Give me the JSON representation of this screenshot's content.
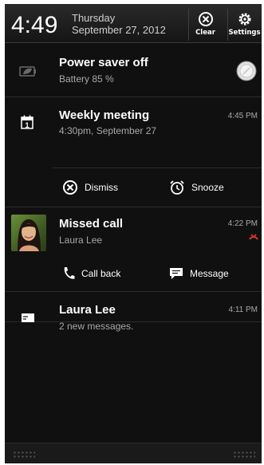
{
  "status": {
    "time": "4:49",
    "day": "Thursday",
    "date": "September 27, 2012",
    "clear_label": "Clear",
    "settings_label": "Settings"
  },
  "notifications": {
    "power": {
      "title": "Power saver off",
      "subtitle": "Battery 85 %",
      "icon": "battery-leaf-icon"
    },
    "meeting": {
      "title": "Weekly meeting",
      "subtitle": "4:30pm, September 27",
      "time": "4:45 PM",
      "calendar_day": "1",
      "actions": {
        "dismiss": "Dismiss",
        "snooze": "Snooze"
      }
    },
    "missed_call": {
      "title": "Missed call",
      "subtitle": "Laura Lee",
      "time": "4:22 PM",
      "actions": {
        "call_back": "Call back",
        "message": "Message"
      }
    },
    "message": {
      "title": "Laura Lee",
      "subtitle": "2 new messages.",
      "time": "4:11 PM"
    }
  },
  "colors": {
    "background": "#101010",
    "text": "#ffffff",
    "secondary_text": "#a8a8a8",
    "missed_icon": "#d23b2a"
  }
}
